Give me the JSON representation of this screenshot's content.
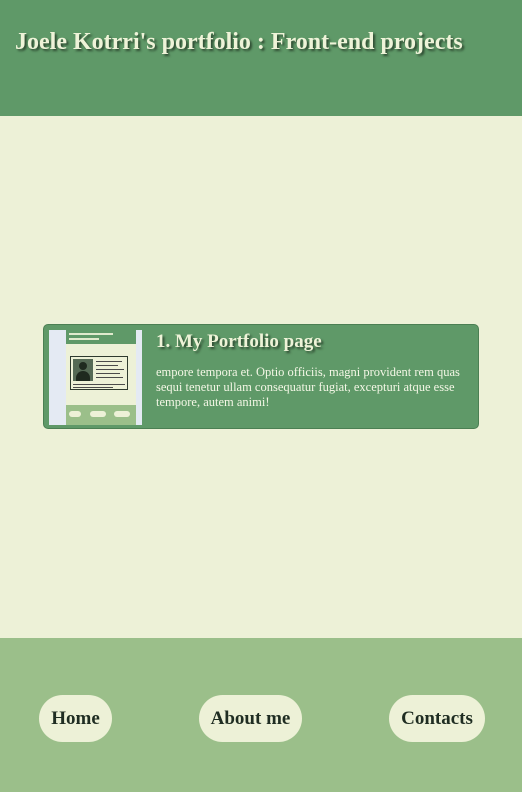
{
  "header": {
    "title": "Joele Kotrri's portfolio : Front-end projects"
  },
  "projects": [
    {
      "title": "1. My Portfolio page",
      "description": "empore tempora et. Optio officiis, magni provident rem quas sequi tenetur ullam consequatur fugiat, excepturi atque esse tempore, autem animi!",
      "thumbnail_icon": "portfolio-screenshot-thumbnail"
    }
  ],
  "footer": {
    "nav": [
      {
        "label": "Home"
      },
      {
        "label": "About me"
      },
      {
        "label": "Contacts"
      }
    ]
  },
  "colors": {
    "header_bg": "#5f9968",
    "page_bg": "#edf1d7",
    "footer_bg": "#9bbf8a",
    "card_bg": "#5f9968",
    "button_bg": "#edf1d7"
  }
}
